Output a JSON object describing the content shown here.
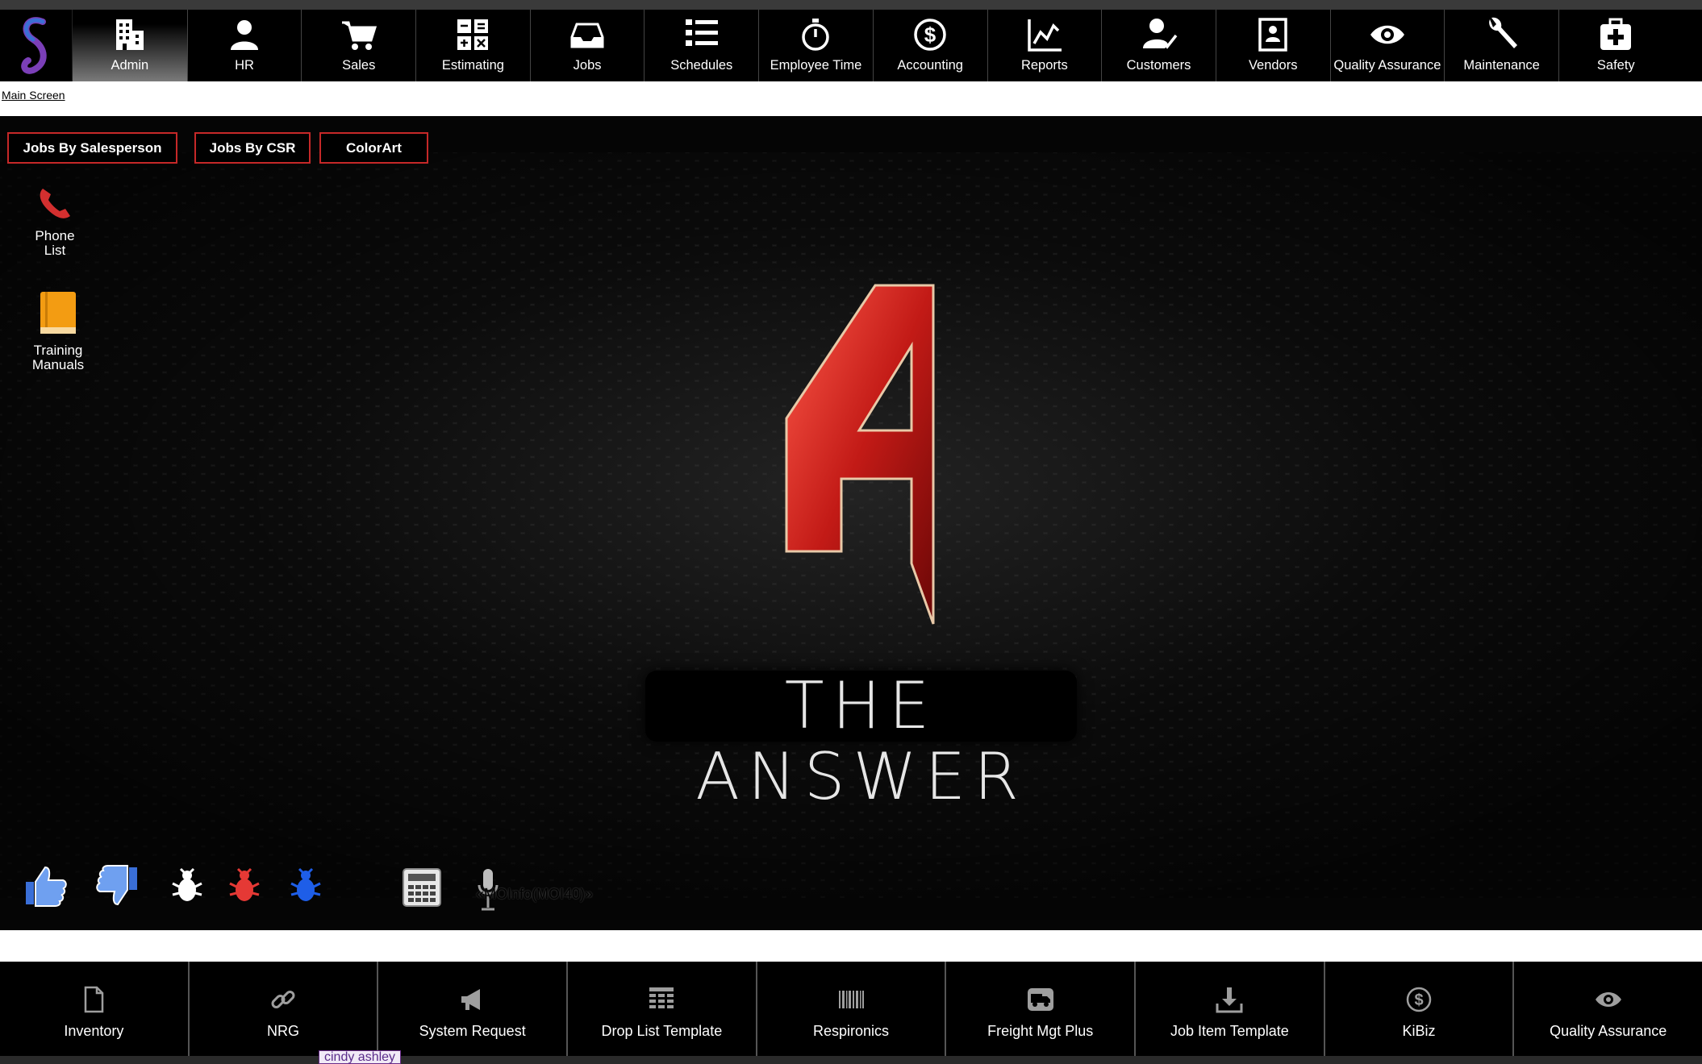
{
  "nav": {
    "items": [
      {
        "label": "Admin",
        "icon": "building-icon",
        "active": true
      },
      {
        "label": "HR",
        "icon": "person-icon"
      },
      {
        "label": "Sales",
        "icon": "cart-icon"
      },
      {
        "label": "Estimating",
        "icon": "calculator-icon"
      },
      {
        "label": "Jobs",
        "icon": "inbox-icon"
      },
      {
        "label": "Schedules",
        "icon": "list-icon"
      },
      {
        "label": "Employee Time",
        "icon": "stopwatch-icon"
      },
      {
        "label": "Accounting",
        "icon": "dollar-icon"
      },
      {
        "label": "Reports",
        "icon": "chart-icon"
      },
      {
        "label": "Customers",
        "icon": "user-check-icon"
      },
      {
        "label": "Vendors",
        "icon": "contact-card-icon"
      },
      {
        "label": "Quality Assurance",
        "icon": "eye-icon"
      },
      {
        "label": "Maintenance",
        "icon": "wrench-icon"
      },
      {
        "label": "Safety",
        "icon": "first-aid-icon"
      }
    ]
  },
  "breadcrumb": {
    "label": "Main Screen"
  },
  "quick_buttons": [
    {
      "label": "Jobs By Salesperson"
    },
    {
      "label": "Jobs By CSR"
    },
    {
      "label": "ColorArt"
    }
  ],
  "desktop_icons": {
    "phone_list": {
      "line1": "Phone",
      "line2": "List"
    },
    "training_manuals": {
      "line1": "Training",
      "line2": "Manuals"
    }
  },
  "logo": {
    "tagline": "THE ANSWER"
  },
  "toolbar": {
    "mic_text": "«MOInfo(MOI40)»"
  },
  "bottom": {
    "items": [
      {
        "label": "Inventory",
        "icon": "document-icon"
      },
      {
        "label": "NRG",
        "icon": "link-icon"
      },
      {
        "label": "System Request",
        "icon": "megaphone-icon"
      },
      {
        "label": "Drop List Template",
        "icon": "table-icon"
      },
      {
        "label": "Respironics",
        "icon": "barcode-icon"
      },
      {
        "label": "Freight Mgt Plus",
        "icon": "truck-icon"
      },
      {
        "label": "Job Item Template",
        "icon": "download-icon"
      },
      {
        "label": "KiBiz",
        "icon": "dollar-icon"
      },
      {
        "label": "Quality Assurance",
        "icon": "eye-icon"
      }
    ]
  },
  "under": {
    "name": "cindy ashley"
  },
  "colors": {
    "accent_red": "#c62828",
    "nav_bg": "#000000",
    "logo_red": "#c21a16"
  }
}
